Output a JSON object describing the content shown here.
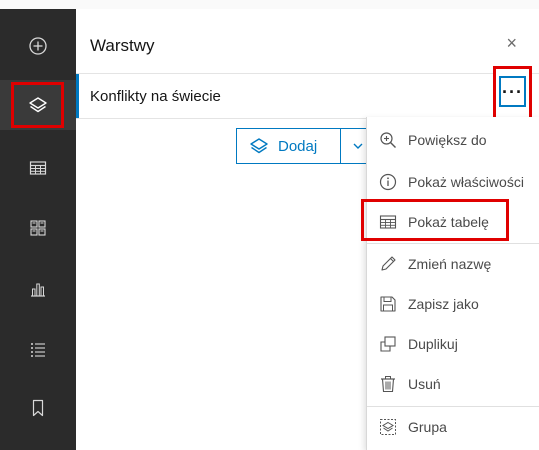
{
  "panel": {
    "title": "Warstwy",
    "close_label": "×"
  },
  "layer": {
    "name": "Konflikty na świecie",
    "more_label": "···"
  },
  "add": {
    "label": "Dodaj"
  },
  "menu": {
    "items": [
      {
        "label": "Powiększ do",
        "icon": "zoom-in-icon"
      },
      {
        "label": "Pokaż właściwości",
        "icon": "info-icon"
      },
      {
        "label": "Pokaż tabelę",
        "icon": "table-icon"
      },
      {
        "label": "Zmień nazwę",
        "icon": "pencil-icon"
      },
      {
        "label": "Zapisz jako",
        "icon": "save-icon"
      },
      {
        "label": "Duplikuj",
        "icon": "duplicate-icon"
      },
      {
        "label": "Usuń",
        "icon": "trash-icon"
      },
      {
        "label": "Grupa",
        "icon": "group-icon"
      }
    ]
  },
  "sidebar": {
    "items": [
      {
        "icon": "add-circle-icon"
      },
      {
        "icon": "layers-icon",
        "active": true
      },
      {
        "icon": "table-icon"
      },
      {
        "icon": "widgets-icon"
      },
      {
        "icon": "chart-icon"
      },
      {
        "icon": "legend-icon"
      },
      {
        "icon": "bookmark-icon"
      }
    ]
  },
  "colors": {
    "accent": "#0079c1",
    "highlight": "#e00000",
    "sidebar_bg": "#2b2b2b"
  }
}
